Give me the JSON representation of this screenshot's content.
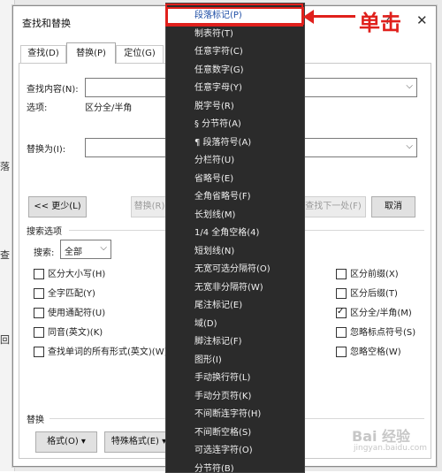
{
  "dialog": {
    "title": "查找和替换",
    "help": "?",
    "close": "✕"
  },
  "tabs": [
    {
      "label": "查找(D)"
    },
    {
      "label": "替换(P)"
    },
    {
      "label": "定位(G)"
    }
  ],
  "find": {
    "label": "查找内容(N):",
    "value": "",
    "options_label": "选项:",
    "options_value": "区分全/半角"
  },
  "replace": {
    "label": "替换为(I):",
    "value": ""
  },
  "buttons": {
    "less": "<< 更少(L)",
    "replace": "替换(R)",
    "find_next": "查找下一处(F)",
    "cancel": "取消"
  },
  "search_options": {
    "title": "搜索选项",
    "search_label": "搜索:",
    "search_value": "全部",
    "left": [
      {
        "label": "区分大小写(H)",
        "checked": false
      },
      {
        "label": "全字匹配(Y)",
        "checked": false
      },
      {
        "label": "使用通配符(U)",
        "checked": false
      },
      {
        "label": "同音(英文)(K)",
        "checked": false
      },
      {
        "label": "查找单词的所有形式(英文)(W)",
        "checked": false
      }
    ],
    "right": [
      {
        "label": "区分前缀(X)",
        "checked": false
      },
      {
        "label": "区分后缀(T)",
        "checked": false
      },
      {
        "label": "区分全/半角(M)",
        "checked": true
      },
      {
        "label": "忽略标点符号(S)",
        "checked": false
      },
      {
        "label": "忽略空格(W)",
        "checked": false
      }
    ]
  },
  "replace_section": {
    "title": "替换",
    "format_btn": "格式(O) ▾",
    "special_btn": "特殊格式(E) ▾"
  },
  "special_menu": {
    "items": [
      "段落标记(P)",
      "制表符(T)",
      "任意字符(C)",
      "任意数字(G)",
      "任意字母(Y)",
      "脱字号(R)",
      "§ 分节符(A)",
      "¶ 段落符号(A)",
      "分栏符(U)",
      "省略号(E)",
      "全角省略号(F)",
      "长划线(M)",
      "1/4 全角空格(4)",
      "短划线(N)",
      "无宽可选分隔符(O)",
      "无宽非分隔符(W)",
      "尾注标记(E)",
      "域(D)",
      "脚注标记(F)",
      "图形(I)",
      "手动换行符(L)",
      "手动分页符(K)",
      "不间断连字符(H)",
      "不间断空格(S)",
      "可选连字符(O)",
      "分节符(B)"
    ],
    "selected_index": 0
  },
  "annotation": {
    "text": "单击",
    "color": "#e0201c"
  },
  "background_doc": {
    "chars": [
      "落",
      "查",
      "回"
    ]
  },
  "watermark": {
    "main": "Bai 经验",
    "sub": "jingyan.baidu.com"
  }
}
